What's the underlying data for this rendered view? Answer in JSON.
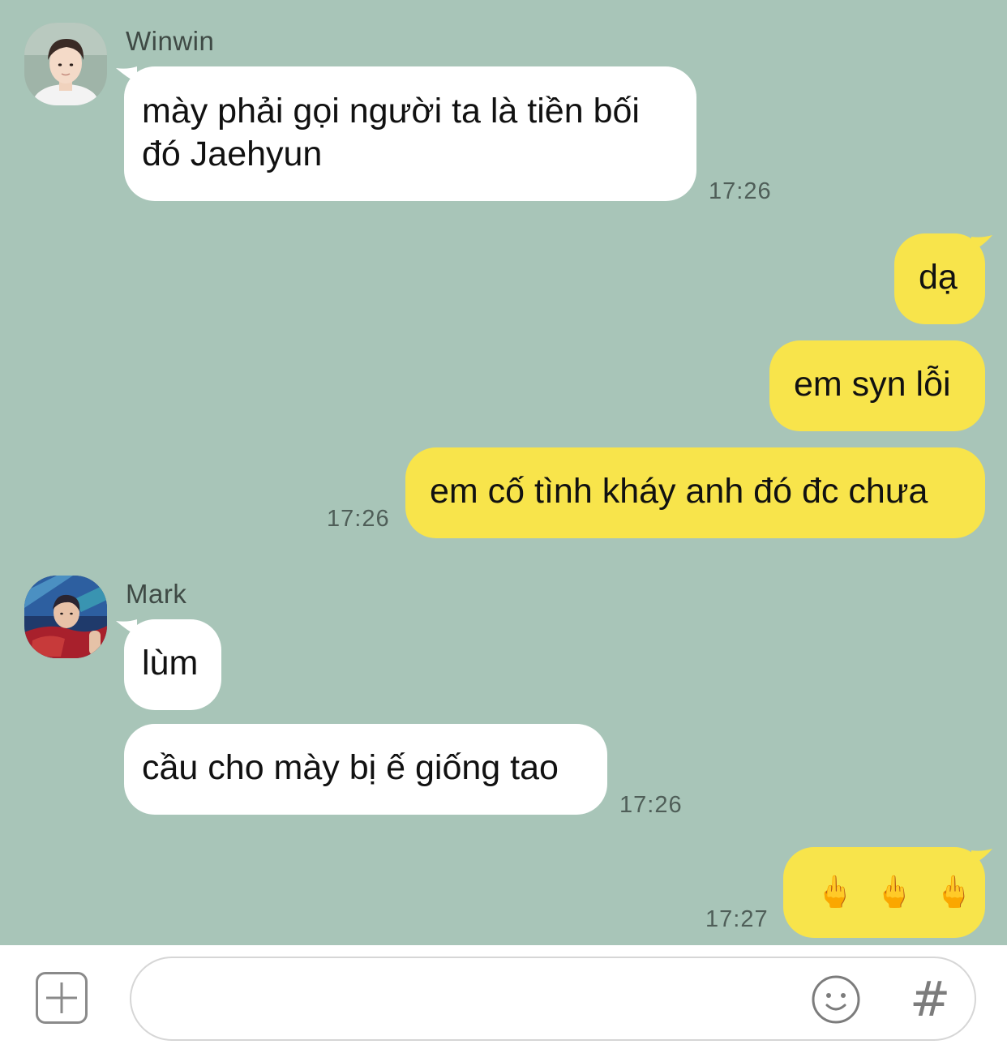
{
  "messages": {
    "m1": {
      "sender": "Winwin",
      "lines": [
        "mày phải gọi người ta là tiền bối",
        "đó Jaehyun"
      ],
      "time": "17:26"
    },
    "m2": {
      "text": "dạ"
    },
    "m3": {
      "text": "em syn lỗi"
    },
    "m4": {
      "text": "em cố tình kháy anh đó đc chưa",
      "time": "17:26"
    },
    "m5": {
      "sender": "Mark",
      "text": "lùm"
    },
    "m6": {
      "text": "cầu cho mày bị ế giống tao",
      "time": "17:26"
    },
    "m7": {
      "emojis": [
        "🖕",
        "🖕",
        "🖕"
      ],
      "time": "17:27"
    }
  },
  "input": {
    "placeholder": "",
    "plus_icon": "plus-icon",
    "emoji_icon": "smiley-icon",
    "hash_label": "#"
  },
  "colors": {
    "background": "#a8c5b8",
    "incoming_bubble": "#ffffff",
    "outgoing_bubble": "#f8e44b"
  }
}
